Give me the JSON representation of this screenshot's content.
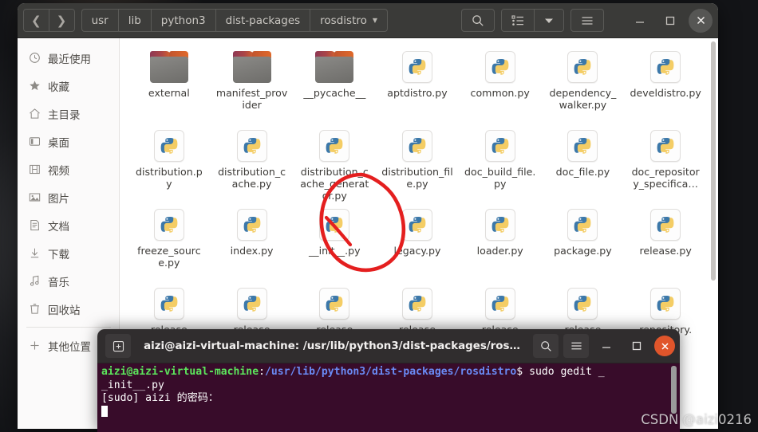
{
  "file_manager": {
    "nav": {
      "back": "❮",
      "forward": "❯"
    },
    "breadcrumbs": [
      {
        "label": "usr"
      },
      {
        "label": "lib"
      },
      {
        "label": "python3"
      },
      {
        "label": "dist-packages"
      },
      {
        "label": "rosdistro"
      }
    ],
    "current_folder": "rosdistro",
    "toolbar": {
      "search_icon": "search-icon",
      "view_list_icon": "list-view-icon",
      "view_dropdown_icon": "chevron-down-icon",
      "menu_icon": "hamburger-menu-icon",
      "minimize": "—",
      "maximize": "□",
      "close": "✕"
    },
    "sidebar": {
      "items": [
        {
          "label": "最近使用",
          "icon": "clock-icon"
        },
        {
          "label": "收藏",
          "icon": "star-icon"
        },
        {
          "label": "主目录",
          "icon": "home-icon"
        },
        {
          "label": "桌面",
          "icon": "desktop-icon"
        },
        {
          "label": "视频",
          "icon": "video-icon"
        },
        {
          "label": "图片",
          "icon": "picture-icon"
        },
        {
          "label": "文档",
          "icon": "document-icon"
        },
        {
          "label": "下载",
          "icon": "download-icon"
        },
        {
          "label": "音乐",
          "icon": "music-icon"
        },
        {
          "label": "回收站",
          "icon": "trash-icon"
        }
      ],
      "other_locations": {
        "label": "其他位置",
        "icon": "plus-icon"
      }
    },
    "files": [
      {
        "name": "external",
        "type": "folder"
      },
      {
        "name": "manifest_provider",
        "type": "folder"
      },
      {
        "name": "__pycache__",
        "type": "folder"
      },
      {
        "name": "aptdistro.py",
        "type": "python"
      },
      {
        "name": "common.py",
        "type": "python"
      },
      {
        "name": "dependency_walker.py",
        "type": "python"
      },
      {
        "name": "develdistro.py",
        "type": "python"
      },
      {
        "name": "distribution.py",
        "type": "python"
      },
      {
        "name": "distribution_cache.py",
        "type": "python"
      },
      {
        "name": "distribution_cache_generator.py",
        "type": "python"
      },
      {
        "name": "distribution_file.py",
        "type": "python"
      },
      {
        "name": "doc_build_file.py",
        "type": "python"
      },
      {
        "name": "doc_file.py",
        "type": "python"
      },
      {
        "name": "doc_repository_specifica…",
        "type": "python"
      },
      {
        "name": "freeze_source.py",
        "type": "python"
      },
      {
        "name": "index.py",
        "type": "python"
      },
      {
        "name": "__init__.py",
        "type": "python"
      },
      {
        "name": "legacy.py",
        "type": "python"
      },
      {
        "name": "loader.py",
        "type": "python"
      },
      {
        "name": "package.py",
        "type": "python"
      },
      {
        "name": "release.py",
        "type": "python"
      },
      {
        "name": "release",
        "type": "python"
      },
      {
        "name": "release",
        "type": "python"
      },
      {
        "name": "release",
        "type": "python"
      },
      {
        "name": "release",
        "type": "python"
      },
      {
        "name": "release",
        "type": "python"
      },
      {
        "name": "release",
        "type": "python"
      },
      {
        "name": "repository.",
        "type": "python"
      }
    ]
  },
  "annotation": {
    "shape": "red-hand-drawn-circle",
    "target": "__init__.py",
    "color": "#e41f1f"
  },
  "terminal": {
    "title": "aizi@aizi-virtual-machine: /usr/lib/python3/dist-packages/ros…",
    "buttons": {
      "new_tab": "new-tab-icon",
      "search": "search-icon",
      "menu": "hamburger-menu-icon",
      "minimize": "—",
      "maximize": "□",
      "close": "✕"
    },
    "prompt": {
      "user_host": "aizi@aizi-virtual-machine",
      "colon": ":",
      "path": "/usr/lib/python3/dist-packages/rosdistro",
      "dollar": "$",
      "command": " sudo gedit _"
    },
    "lines": [
      "_init__.py",
      "[sudo] aizi 的密码："
    ]
  },
  "watermark": {
    "text": "CSDN @aizi0216"
  }
}
